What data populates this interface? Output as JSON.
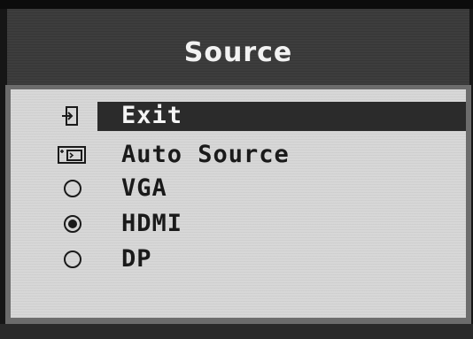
{
  "menu": {
    "title": "Source",
    "items": [
      {
        "label": "Exit",
        "icon": "exit-icon",
        "selected": true
      },
      {
        "label": "Auto Source",
        "icon": "auto-source-icon",
        "selected": false
      },
      {
        "label": "VGA",
        "icon": "radio-empty-icon",
        "checked": false
      },
      {
        "label": "HDMI",
        "icon": "radio-filled-icon",
        "checked": true
      },
      {
        "label": "DP",
        "icon": "radio-empty-icon",
        "checked": false
      }
    ]
  },
  "colors": {
    "header_bg": "#3d3d3d",
    "panel_bg": "#d7d7d7",
    "highlight_bg": "#2b2b2b",
    "text_dark": "#1a1a1a",
    "text_light": "#f4f4f4"
  }
}
